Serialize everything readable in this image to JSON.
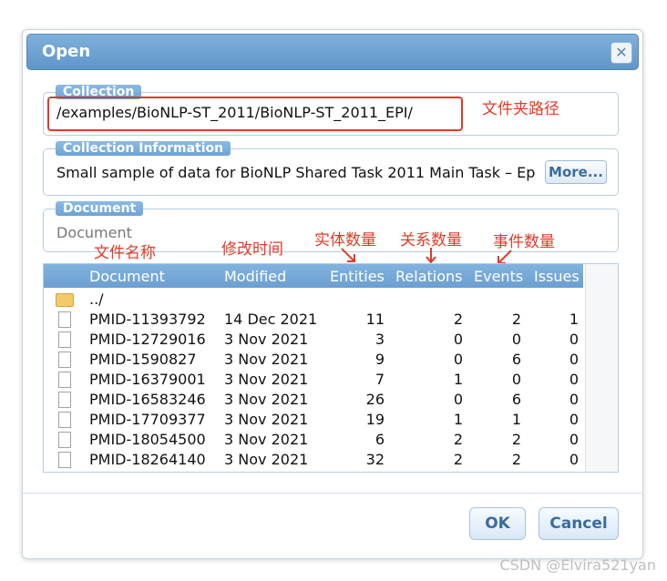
{
  "dialog": {
    "title": "Open",
    "close_icon": "close-icon"
  },
  "collection": {
    "legend": "Collection",
    "path": "/examples/BioNLP-ST_2011/BioNLP-ST_2011_EPI/"
  },
  "collection_info": {
    "legend": "Collection Information",
    "text": "Small sample of data for BioNLP Shared Task 2011 Main Task – Ep",
    "more_label": "More..."
  },
  "document": {
    "legend": "Document",
    "placeholder": "Document"
  },
  "table": {
    "headers": [
      "Document",
      "Modified",
      "Entities",
      "Relations",
      "Events",
      "Issues"
    ],
    "parent": "../",
    "rows": [
      {
        "doc": "PMID-11393792",
        "modified": "14 Dec 2021",
        "entities": "11",
        "relations": "2",
        "events": "2",
        "issues": "1"
      },
      {
        "doc": "PMID-12729016",
        "modified": "3 Nov 2021",
        "entities": "3",
        "relations": "0",
        "events": "0",
        "issues": "0"
      },
      {
        "doc": "PMID-1590827",
        "modified": "3 Nov 2021",
        "entities": "9",
        "relations": "0",
        "events": "6",
        "issues": "0"
      },
      {
        "doc": "PMID-16379001",
        "modified": "3 Nov 2021",
        "entities": "7",
        "relations": "1",
        "events": "0",
        "issues": "0"
      },
      {
        "doc": "PMID-16583246",
        "modified": "3 Nov 2021",
        "entities": "26",
        "relations": "0",
        "events": "6",
        "issues": "0"
      },
      {
        "doc": "PMID-17709377",
        "modified": "3 Nov 2021",
        "entities": "19",
        "relations": "1",
        "events": "1",
        "issues": "0"
      },
      {
        "doc": "PMID-18054500",
        "modified": "3 Nov 2021",
        "entities": "6",
        "relations": "2",
        "events": "2",
        "issues": "0"
      },
      {
        "doc": "PMID-18264140",
        "modified": "3 Nov 2021",
        "entities": "32",
        "relations": "2",
        "events": "2",
        "issues": "0"
      }
    ]
  },
  "annotations": {
    "folder_path": "文件夹路径",
    "file_name": "文件名称",
    "modify_time": "修改时间",
    "entity_count": "实体数量",
    "relation_count": "关系数量",
    "event_count": "事件数量",
    "color": "#e03a28"
  },
  "buttons": {
    "ok": "OK",
    "cancel": "Cancel"
  },
  "watermark": "CSDN @Elvira521yan"
}
